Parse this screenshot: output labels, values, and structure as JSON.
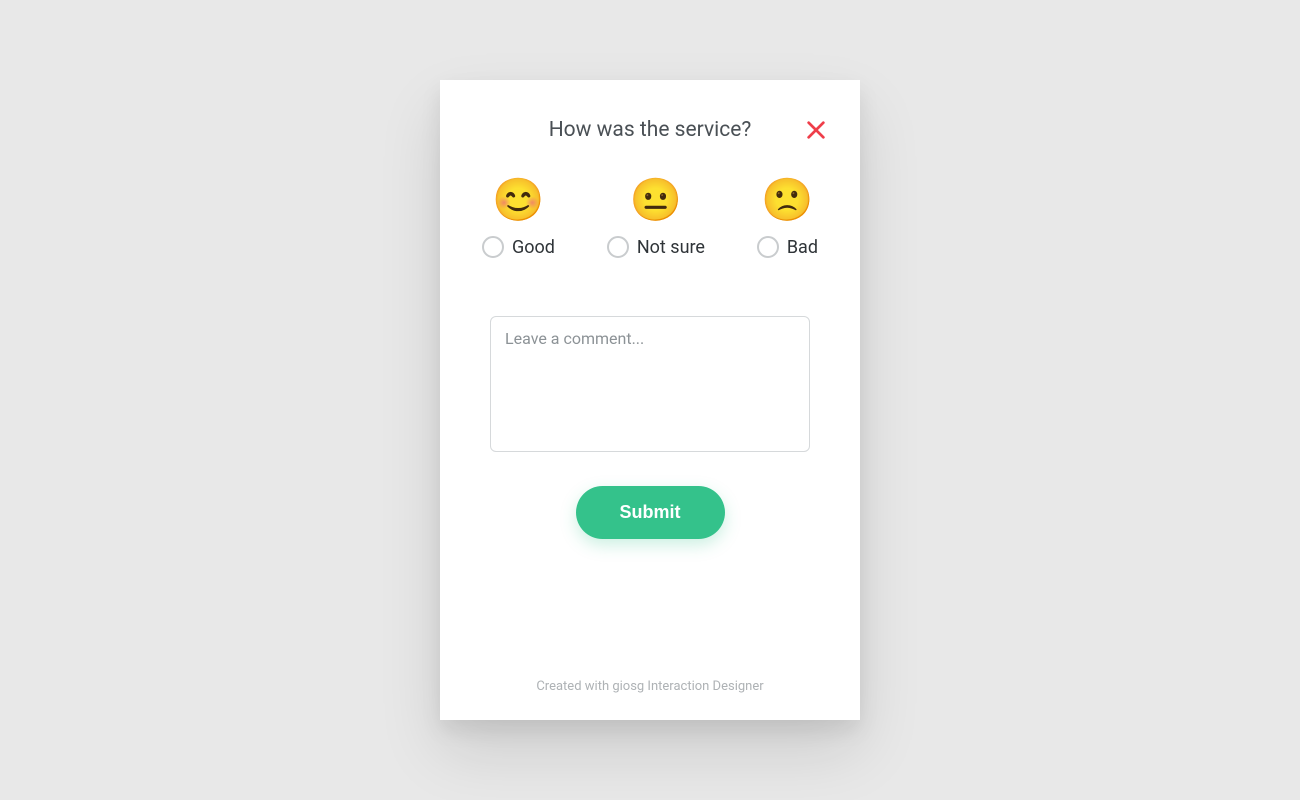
{
  "title": "How was the service?",
  "options": [
    {
      "label": "Good",
      "emoji": "😊"
    },
    {
      "label": "Not sure",
      "emoji": "😐"
    },
    {
      "label": "Bad",
      "emoji": "🙁"
    }
  ],
  "comment": {
    "placeholder": "Leave a comment...",
    "value": ""
  },
  "submit_label": "Submit",
  "footer_text": "Created with giosg Interaction Designer",
  "colors": {
    "accent": "#34c28b",
    "close": "#ef3e4a"
  }
}
